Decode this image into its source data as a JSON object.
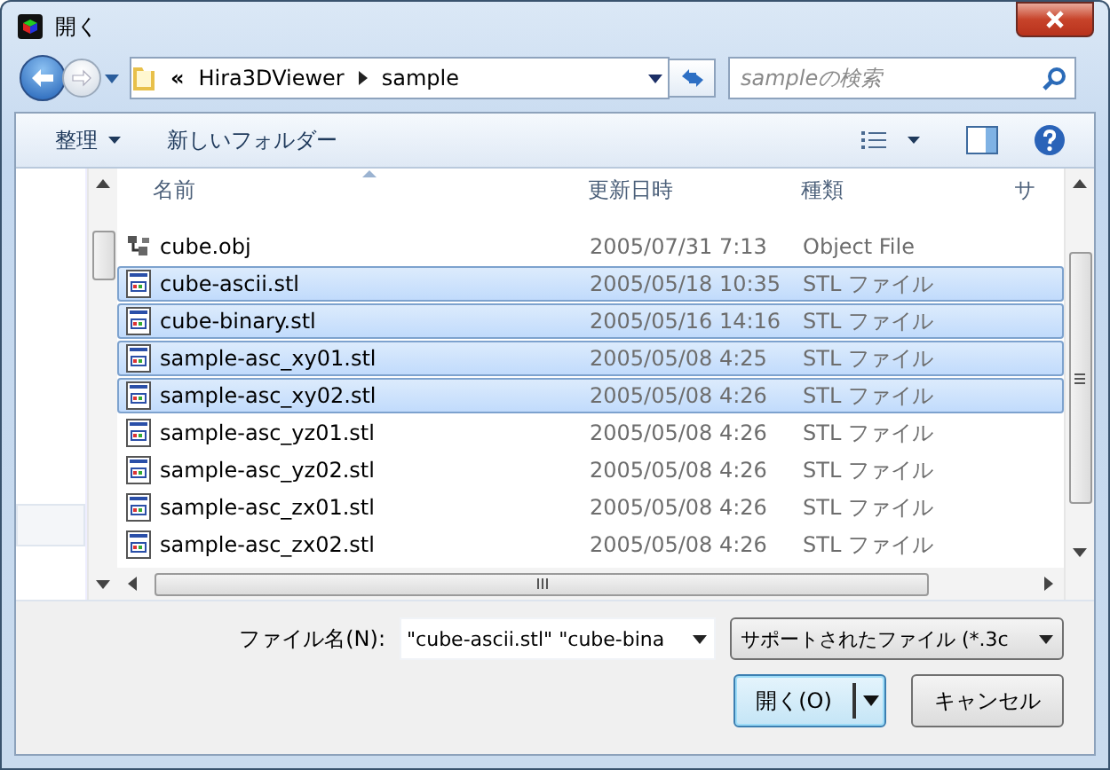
{
  "window": {
    "title": "開く"
  },
  "nav": {
    "path": [
      {
        "label": "«"
      },
      {
        "label": "Hira3DViewer"
      },
      {
        "label": "sample"
      }
    ],
    "search": {
      "placeholder": "sampleの検索"
    }
  },
  "toolbar": {
    "organize": "整理",
    "new_folder": "新しいフォルダー"
  },
  "table": {
    "columns": [
      "名前",
      "更新日時",
      "種類",
      "サ"
    ],
    "rows": [
      {
        "kind": "obj",
        "name": "cube.obj",
        "date": "2005/07/31 7:13",
        "type": "Object File",
        "selected": false
      },
      {
        "kind": "stl",
        "name": "cube-ascii.stl",
        "date": "2005/05/18 10:35",
        "type": "STL ファイル",
        "selected": true
      },
      {
        "kind": "stl",
        "name": "cube-binary.stl",
        "date": "2005/05/16 14:16",
        "type": "STL ファイル",
        "selected": true
      },
      {
        "kind": "stl",
        "name": "sample-asc_xy01.stl",
        "date": "2005/05/08 4:25",
        "type": "STL ファイル",
        "selected": true
      },
      {
        "kind": "stl",
        "name": "sample-asc_xy02.stl",
        "date": "2005/05/08 4:26",
        "type": "STL ファイル",
        "selected": true
      },
      {
        "kind": "stl",
        "name": "sample-asc_yz01.stl",
        "date": "2005/05/08 4:26",
        "type": "STL ファイル",
        "selected": false
      },
      {
        "kind": "stl",
        "name": "sample-asc_yz02.stl",
        "date": "2005/05/08 4:26",
        "type": "STL ファイル",
        "selected": false
      },
      {
        "kind": "stl",
        "name": "sample-asc_zx01.stl",
        "date": "2005/05/08 4:26",
        "type": "STL ファイル",
        "selected": false
      },
      {
        "kind": "stl",
        "name": "sample-asc_zx02.stl",
        "date": "2005/05/08 4:26",
        "type": "STL ファイル",
        "selected": false
      }
    ]
  },
  "footer": {
    "filename_label": "ファイル名(N):",
    "filename": "\"cube-ascii.stl\" \"cube-bina",
    "filter": "サポートされたファイル (*.3c",
    "open_button": "開く(O)",
    "cancel_button": "キャンセル"
  }
}
